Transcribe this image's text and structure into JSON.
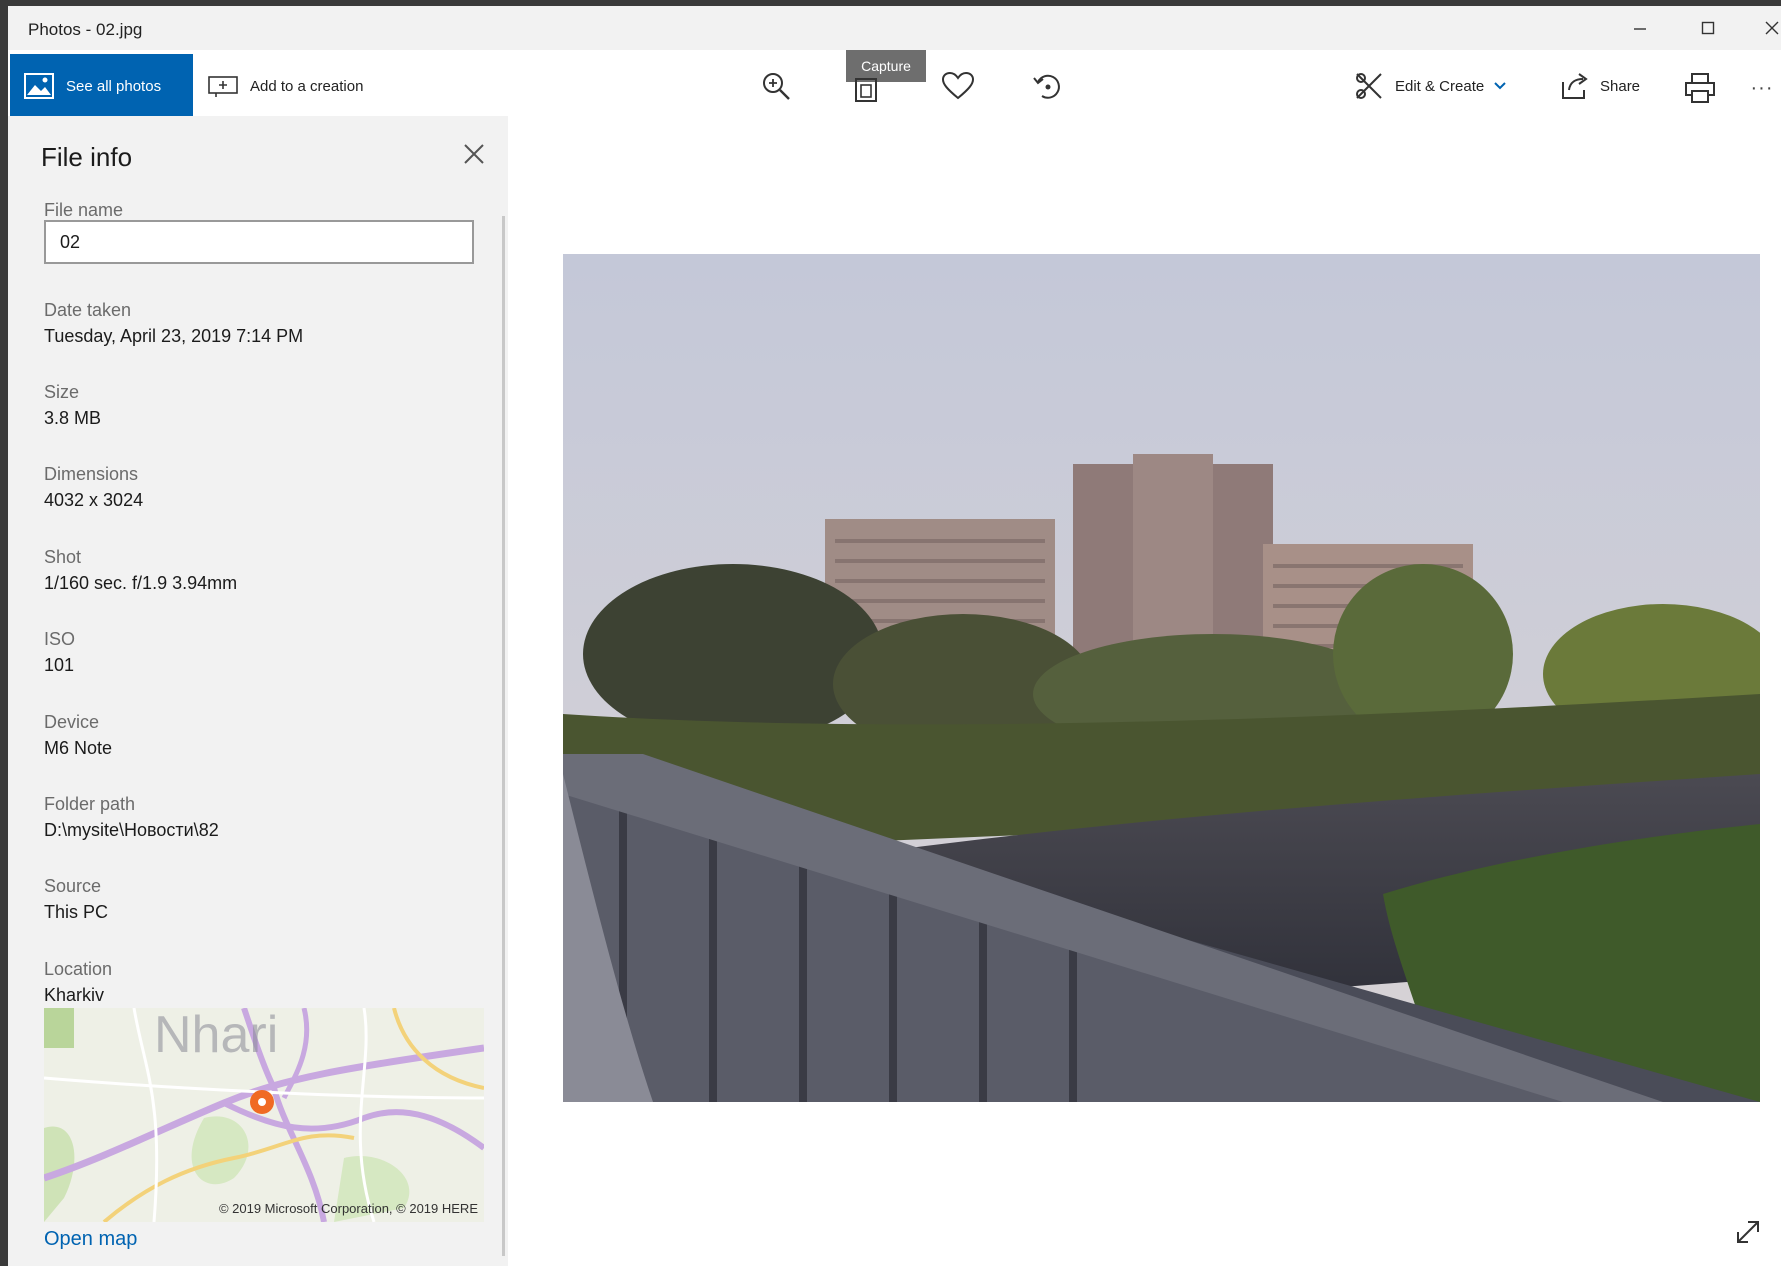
{
  "window": {
    "title": "Photos - 02.jpg",
    "controls": {
      "minimize": "minimize-icon",
      "maximize": "maximize-icon",
      "close": "close-icon"
    }
  },
  "toolbar": {
    "see_all_photos": "See all photos",
    "add_to_creation": "Add to a creation",
    "capture_tooltip": "Capture",
    "edit_create": "Edit & Create",
    "share": "Share",
    "more": "···",
    "icons": [
      "photos-icon",
      "add-creation-icon",
      "zoom-in-icon",
      "capture-icon",
      "favorite-heart-icon",
      "rotate-icon",
      "edit-create-icon",
      "chevron-down-icon",
      "share-icon",
      "print-icon",
      "more-icon"
    ]
  },
  "file_info": {
    "title": "File info",
    "file_name_label": "File name",
    "file_name_value": "02",
    "date_taken_label": "Date taken",
    "date_taken_value": "Tuesday, April 23, 2019 7:14 PM",
    "size_label": "Size",
    "size_value": "3.8 MB",
    "dimensions_label": "Dimensions",
    "dimensions_value": "4032 x 3024",
    "shot_label": "Shot",
    "shot_value": "1/160 sec. f/1.9 3.94mm",
    "iso_label": "ISO",
    "iso_value": "101",
    "device_label": "Device",
    "device_value": "M6 Note",
    "folder_path_label": "Folder path",
    "folder_path_value": "D:\\mysite\\Новости\\82",
    "source_label": "Source",
    "source_value": "This PC",
    "location_label": "Location",
    "location_value": "Kharkiv",
    "map_copyright": "© 2019 Microsoft Corporation, © 2019 HERE",
    "open_map": "Open map"
  },
  "colors": {
    "accent": "#0063b1",
    "panel_bg": "#f2f2f2",
    "titlebar_bg": "#f2f2f2"
  }
}
